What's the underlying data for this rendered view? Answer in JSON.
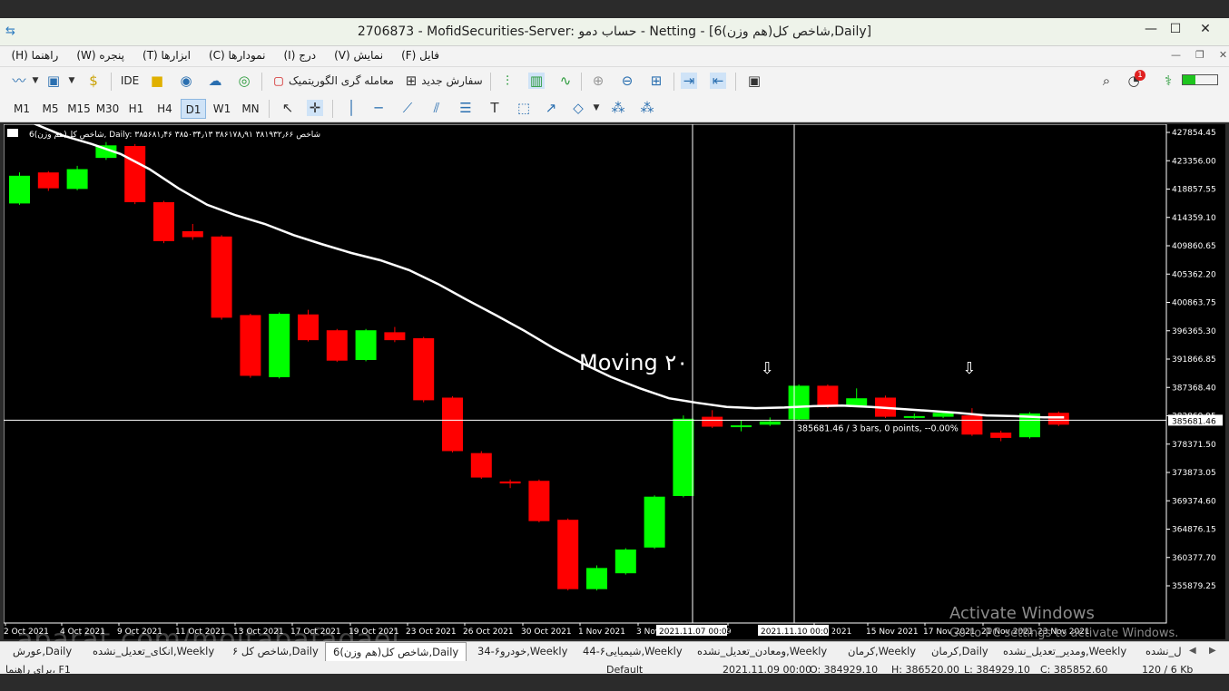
{
  "window": {
    "title": "2706873 - MofidSecurities-Server: حساب دمو - Netting - [6(هم وزن)شاخص کل,Daily]",
    "min_icon": "minimize-icon",
    "max_icon": "maximize-icon",
    "close_icon": "close-icon"
  },
  "menu": [
    "فایل (F)",
    "نمایش (V)",
    "درج (I)",
    "نمودارها (C)",
    "ابزارها (T)",
    "پنجره (W)",
    "راهنما (H)"
  ],
  "toolbar": {
    "ide_label": "IDE",
    "algo_label": "معامله گری الگوریتمیک",
    "new_order_label": "سفارش جدید",
    "notification_count": "1"
  },
  "timeframes": [
    "M1",
    "M5",
    "M15",
    "M30",
    "H1",
    "H4",
    "D1",
    "W1",
    "MN"
  ],
  "active_timeframe": "D1",
  "chart": {
    "header_text": "6(هم وزن)شاخص کل, Daily:  ۳۸۵۶۸۱٫۴۶ ۳۸۵۰۳۴٫۱۳ ۳۸۶۱۷۸٫۹۱ ۳۸۱۹۳۲٫۶۶ شاخص",
    "moving_label": "Moving ۲۰",
    "crosshair_label": "385681.46 / 3 bars, 0 points, --0.00%",
    "current_price": "385681.46",
    "price_axis": [
      "427854.45",
      "423356.00",
      "418857.55",
      "414359.10",
      "409860.65",
      "405362.20",
      "400863.75",
      "396365.30",
      "391866.85",
      "387368.40",
      "382869.95",
      "378371.50",
      "373873.05",
      "369374.60",
      "364876.15",
      "360377.70",
      "355879.25"
    ],
    "date_axis": [
      "2 Oct 2021",
      "4 Oct 2021",
      "9 Oct 2021",
      "11 Oct 2021",
      "13 Oct 2021",
      "17 Oct 2021",
      "19 Oct 2021",
      "23 Oct 2021",
      "26 Oct 2021",
      "30 Oct 2021",
      "1 Nov 2021",
      "3 Nov",
      "9",
      "Nov 2021",
      "15 Nov 2021",
      "17 Nov 2021",
      "21 Nov 2021",
      "23 Nov 2021"
    ],
    "cursor_dates": [
      "2021.11.07 00:00",
      "2021.11.10 00:00"
    ],
    "colors": {
      "up": "#00ff00",
      "down": "#ff0000",
      "ma": "#ffffff",
      "bg": "#000000"
    }
  },
  "chart_data": {
    "type": "candlestick",
    "title": "",
    "ylim": [
      352500,
      430500
    ],
    "candles": [
      {
        "o": 418500,
        "c": 422700,
        "h": 423200,
        "l": 418300
      },
      {
        "o": 423200,
        "c": 420800,
        "h": 423400,
        "l": 420400
      },
      {
        "o": 420700,
        "c": 423700,
        "h": 424200,
        "l": 420500
      },
      {
        "o": 425400,
        "c": 427300,
        "h": 427800,
        "l": 425100
      },
      {
        "o": 427200,
        "c": 418700,
        "h": 427500,
        "l": 418400
      },
      {
        "o": 418700,
        "c": 412800,
        "h": 418900,
        "l": 412500
      },
      {
        "o": 414300,
        "c": 413400,
        "h": 415400,
        "l": 413000
      },
      {
        "o": 413500,
        "c": 401200,
        "h": 413700,
        "l": 400900
      },
      {
        "o": 401600,
        "c": 392400,
        "h": 401800,
        "l": 392100
      },
      {
        "o": 392200,
        "c": 401800,
        "h": 402000,
        "l": 392000
      },
      {
        "o": 401700,
        "c": 397800,
        "h": 402400,
        "l": 397600
      },
      {
        "o": 399300,
        "c": 394700,
        "h": 399500,
        "l": 394500
      },
      {
        "o": 394800,
        "c": 399300,
        "h": 399500,
        "l": 394600
      },
      {
        "o": 399000,
        "c": 397800,
        "h": 399800,
        "l": 397500
      },
      {
        "o": 398100,
        "c": 388700,
        "h": 398300,
        "l": 388400
      },
      {
        "o": 389100,
        "c": 381000,
        "h": 389300,
        "l": 380800
      },
      {
        "o": 380700,
        "c": 377000,
        "h": 381000,
        "l": 376800
      },
      {
        "o": 376400,
        "c": 376100,
        "h": 376700,
        "l": 375400
      },
      {
        "o": 376500,
        "c": 370400,
        "h": 376700,
        "l": 370200
      },
      {
        "o": 370600,
        "c": 360100,
        "h": 370800,
        "l": 359900
      },
      {
        "o": 360100,
        "c": 363300,
        "h": 363700,
        "l": 359900
      },
      {
        "o": 362500,
        "c": 366100,
        "h": 366300,
        "l": 362300
      },
      {
        "o": 366400,
        "c": 374100,
        "h": 374300,
        "l": 366200
      },
      {
        "o": 374200,
        "c": 385900,
        "h": 386400,
        "l": 374000
      },
      {
        "o": 386200,
        "c": 384700,
        "h": 387200,
        "l": 384500
      },
      {
        "o": 384700,
        "c": 384900,
        "h": 385600,
        "l": 384000
      },
      {
        "o": 385000,
        "c": 385500,
        "h": 386100,
        "l": 384800
      },
      {
        "o": 385800,
        "c": 390900,
        "h": 391100,
        "l": 385600
      },
      {
        "o": 390900,
        "c": 387700,
        "h": 391100,
        "l": 387500
      },
      {
        "o": 387900,
        "c": 389000,
        "h": 390500,
        "l": 387700
      },
      {
        "o": 389100,
        "c": 386200,
        "h": 389400,
        "l": 386000
      },
      {
        "o": 386100,
        "c": 386300,
        "h": 386700,
        "l": 385900
      },
      {
        "o": 386200,
        "c": 386800,
        "h": 387000,
        "l": 386000
      },
      {
        "o": 386400,
        "c": 383500,
        "h": 387500,
        "l": 383300
      },
      {
        "o": 383800,
        "c": 383000,
        "h": 384100,
        "l": 382500
      },
      {
        "o": 383100,
        "c": 386700,
        "h": 386900,
        "l": 382900
      },
      {
        "o": 386800,
        "c": 385000,
        "h": 387000,
        "l": 384800
      }
    ],
    "moving_average": [
      433000,
      430600,
      428800,
      427500,
      426000,
      423700,
      420800,
      418300,
      416700,
      415400,
      413700,
      412300,
      411000,
      409900,
      408400,
      406300,
      403900,
      401600,
      399200,
      396600,
      394300,
      392200,
      390500,
      389000,
      388300,
      387700,
      387500,
      387600,
      387800,
      387900,
      387700,
      387400,
      387100,
      386800,
      386400,
      386300,
      386100
    ],
    "markers": [
      {
        "index": 26,
        "type": "down-arrow"
      },
      {
        "index": 33,
        "type": "down-arrow"
      }
    ]
  },
  "tabs": [
    "عورش,Daily",
    "انکای_تعدیل_نشده,Weekly",
    "شاخص کل ۶,Daily",
    "6(هم وزن)شاخص کل,Daily",
    "خودرو۶-34,Weekly",
    "شیمیایی۶-44,Weekly",
    "ومعادن_تعدیل_نشده,Weekly",
    "کرمان,Weekly",
    "کرمان,Daily",
    "ومدیر_تعدیل_نشده,Weekly",
    "ل_نشده"
  ],
  "active_tab": "6(هم وزن)شاخص کل,Daily",
  "status": {
    "help": "برای راهنما، F1",
    "profile": "Default",
    "datetime": "2021.11.09 00:00",
    "open": "O: 384929.10",
    "high": "H: 386520.00",
    "low": "L: 384929.10",
    "close": "C: 385852.60",
    "traffic": "120 / 6 Kb"
  },
  "watermark": {
    "line1": "Activate Windows",
    "line2": "Go to PC settings to activate Windows.",
    "site": "aparat.com/mojtabafadaei"
  }
}
